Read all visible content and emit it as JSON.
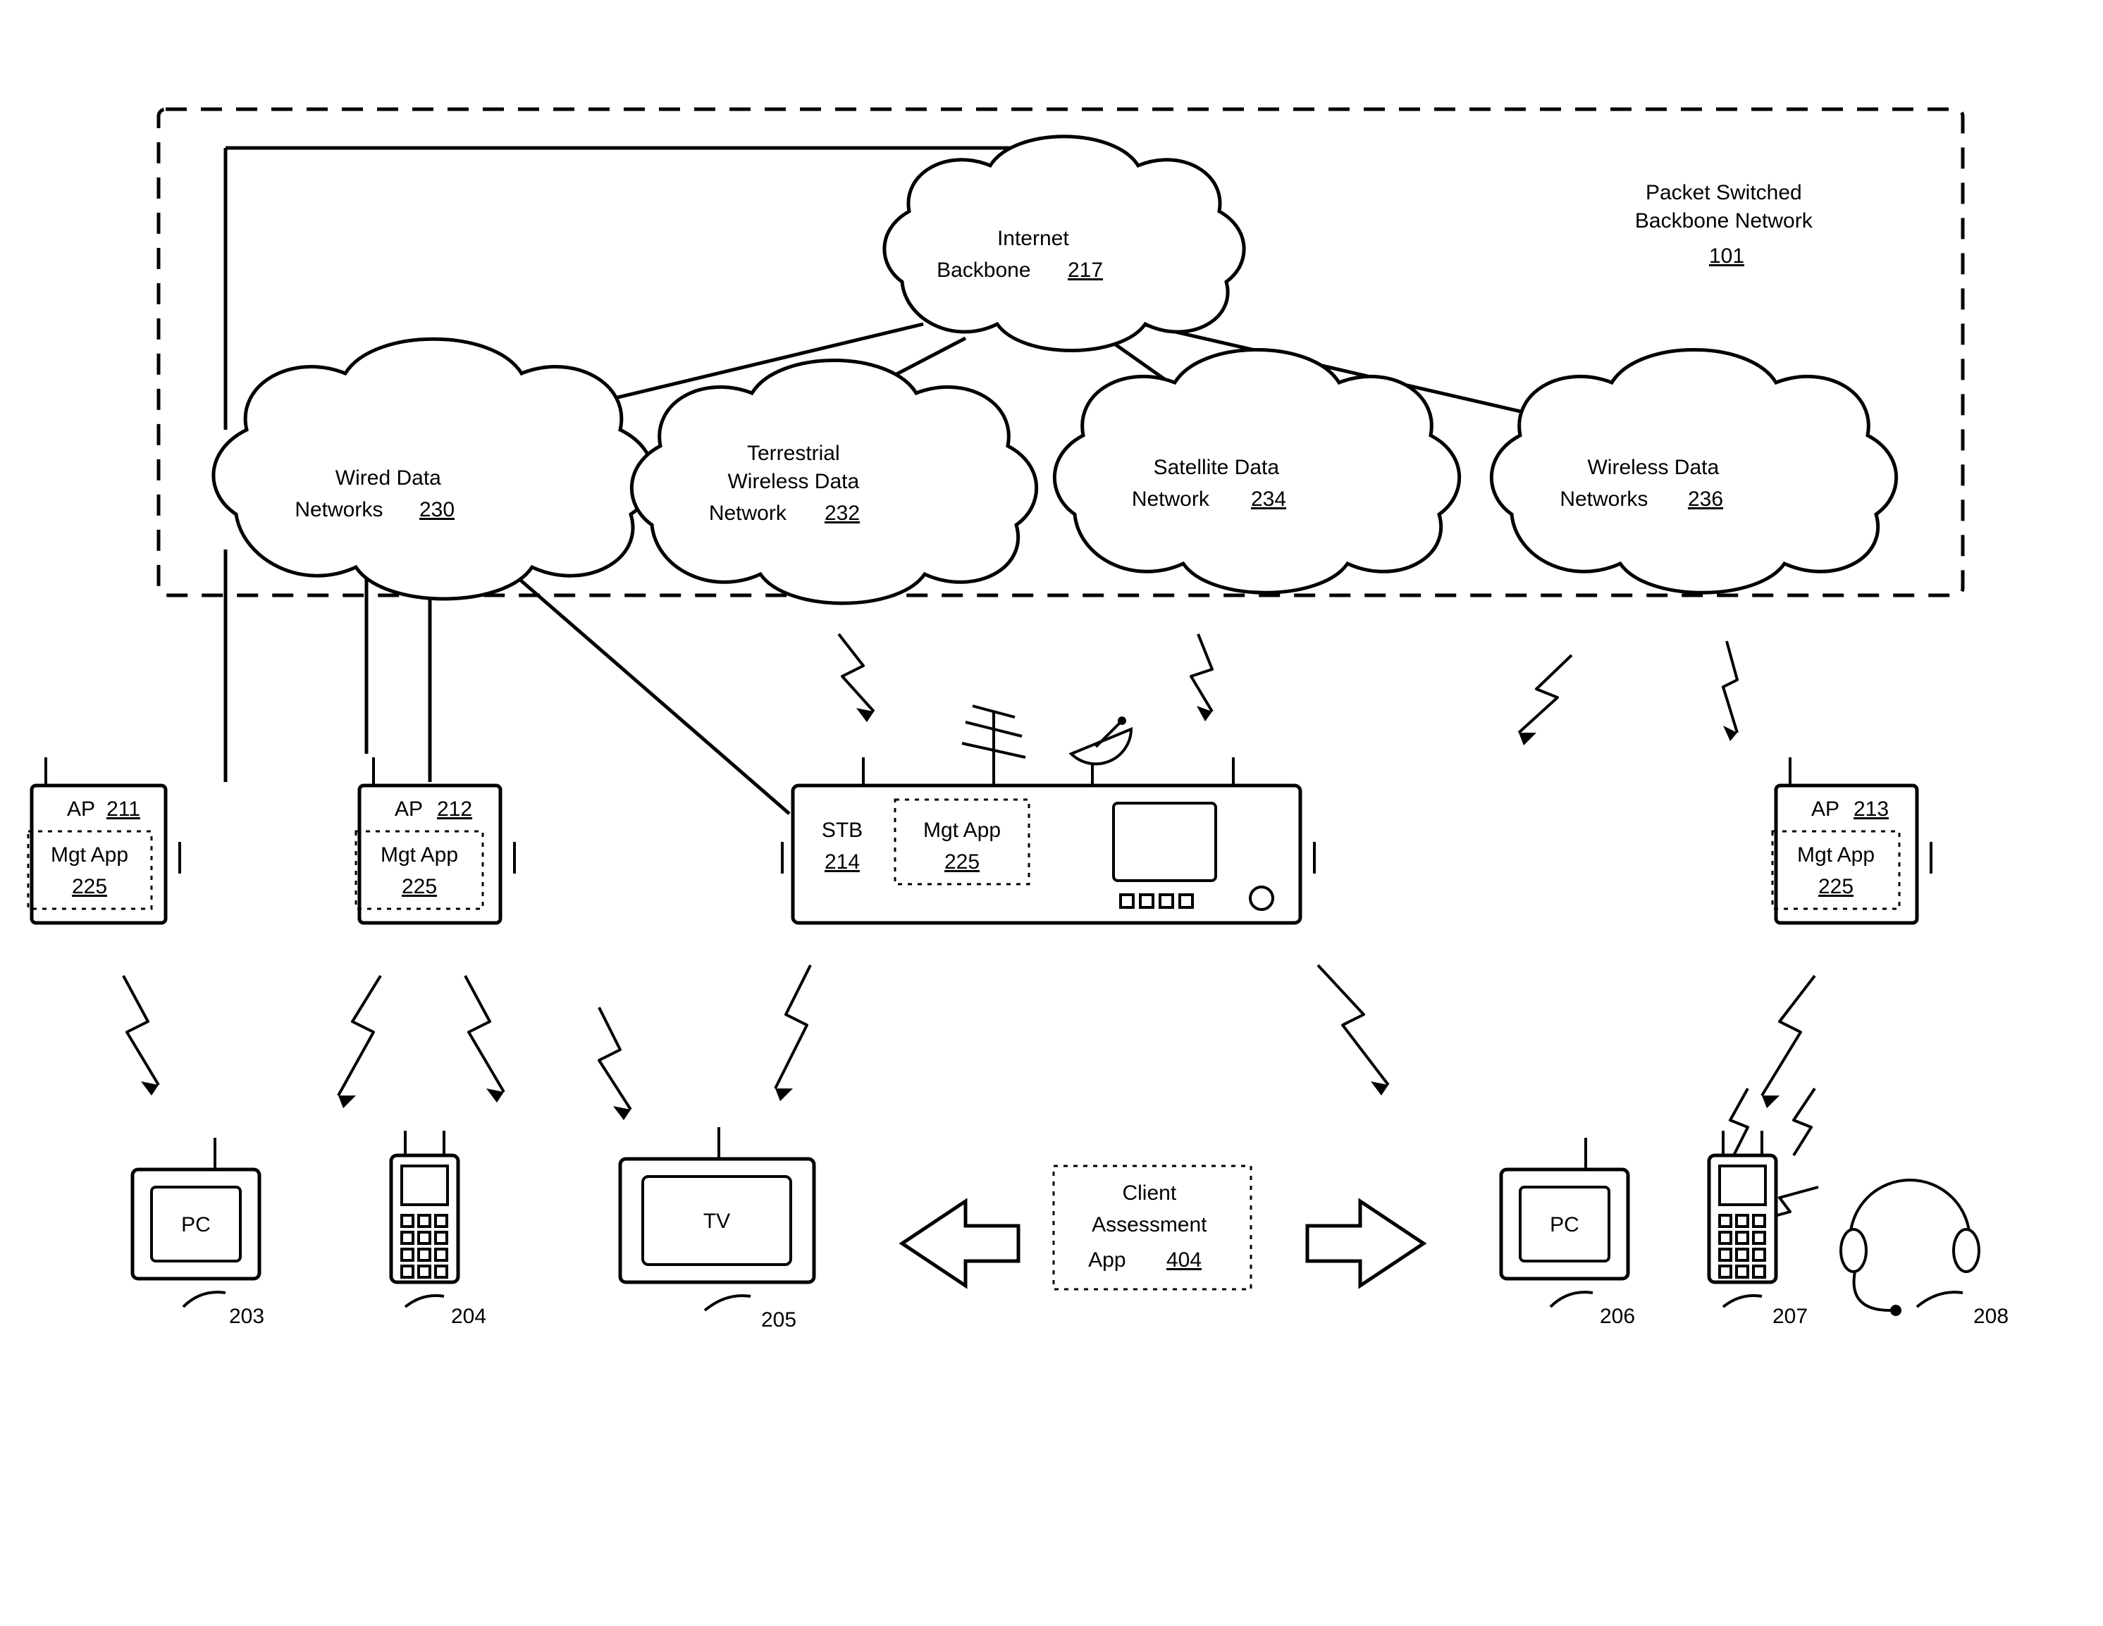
{
  "backbone": {
    "line1": "Packet Switched",
    "line2": "Backbone Network",
    "num": "101"
  },
  "clouds": {
    "internet": {
      "line1": "Internet",
      "line2": "Backbone",
      "num": "217"
    },
    "wired": {
      "line1": "Wired Data",
      "line2": "Networks",
      "num": "230"
    },
    "terr": {
      "line1": "Terrestrial",
      "line2": "Wireless Data",
      "line3": "Network",
      "num": "232"
    },
    "sat": {
      "line1": "Satellite Data",
      "line2": "Network",
      "num": "234"
    },
    "wireless": {
      "line1": "Wireless Data",
      "line2": "Networks",
      "num": "236"
    }
  },
  "aps": {
    "ap1": {
      "label": "AP",
      "num": "211",
      "mgt_line1": "Mgt App",
      "mgt_num": "225"
    },
    "ap2": {
      "label": "AP",
      "num": "212",
      "mgt_line1": "Mgt App",
      "mgt_num": "225"
    },
    "ap3": {
      "label": "AP",
      "num": "213",
      "mgt_line1": "Mgt App",
      "mgt_num": "225"
    }
  },
  "stb": {
    "label": "STB",
    "num": "214",
    "mgt_line1": "Mgt App",
    "mgt_num": "225"
  },
  "devices": {
    "pc1": {
      "label": "PC",
      "num": "203"
    },
    "phone1": {
      "num": "204"
    },
    "tv": {
      "label": "TV",
      "num": "205"
    },
    "pc2": {
      "label": "PC",
      "num": "206"
    },
    "phone2": {
      "num": "207"
    },
    "headset": {
      "num": "208"
    }
  },
  "client_app": {
    "line1": "Client",
    "line2": "Assessment",
    "line3": "App",
    "num": "404"
  }
}
